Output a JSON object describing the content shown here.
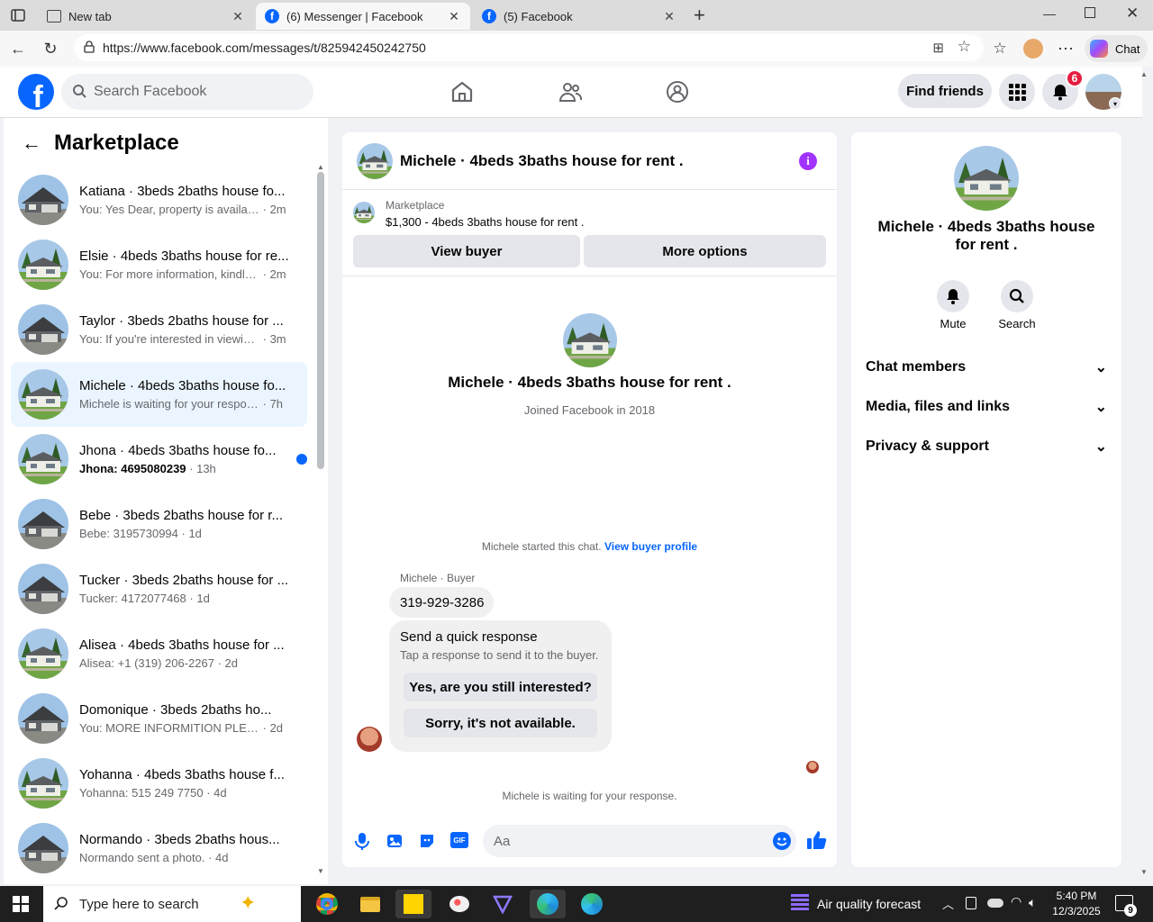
{
  "browser": {
    "tabs": [
      {
        "title": "New tab",
        "active": false
      },
      {
        "title": "(6) Messenger | Facebook",
        "active": true
      },
      {
        "title": "(5) Facebook",
        "active": false
      }
    ],
    "url": "https://www.facebook.com/messages/t/825942450242750",
    "copilot_label": "Chat"
  },
  "fb": {
    "search_placeholder": "Search Facebook",
    "find_friends": "Find friends",
    "notif_count": "6"
  },
  "sidebar": {
    "title": "Marketplace",
    "conversations": [
      {
        "name": "Katiana · 3beds 2baths house fo...",
        "preview": "You: Yes Dear, property is available...",
        "time": "2m",
        "house": "gray",
        "active": false,
        "bold": false,
        "unread": false
      },
      {
        "name": "Elsie · 4beds 3baths house for re...",
        "preview": "You: For more information, kindly s...",
        "time": "2m",
        "house": "white",
        "active": false,
        "bold": false,
        "unread": false
      },
      {
        "name": "Taylor · 3beds 2baths house for ...",
        "preview": "You: If you're interested in viewing ...",
        "time": "3m",
        "house": "gray",
        "active": false,
        "bold": false,
        "unread": false
      },
      {
        "name": "Michele · 4beds 3baths house fo...",
        "preview": "Michele is waiting for your response.",
        "time": "7h",
        "house": "white",
        "active": true,
        "bold": false,
        "unread": false
      },
      {
        "name": "Jhona · 4beds 3baths house fo...",
        "preview": "Jhona: 4695080239",
        "time": "13h",
        "house": "white",
        "active": false,
        "bold": true,
        "unread": true
      },
      {
        "name": "Bebe · 3beds 2baths house for r...",
        "preview": "Bebe: 3195730994",
        "time": "1d",
        "house": "gray",
        "active": false,
        "bold": false,
        "unread": false
      },
      {
        "name": "Tucker · 3beds 2baths house for ...",
        "preview": "Tucker: 4172077468",
        "time": "1d",
        "house": "gray",
        "active": false,
        "bold": false,
        "unread": false
      },
      {
        "name": "Alisea · 4beds 3baths house for ...",
        "preview": "Alisea: +1 (319) 206-2267",
        "time": "2d",
        "house": "white",
        "active": false,
        "bold": false,
        "unread": false
      },
      {
        "name": "Domonique · 3beds 2baths ho...",
        "preview": "You: MORE INFORMITION PLEA...",
        "time": "2d",
        "house": "gray",
        "active": false,
        "bold": false,
        "unread": false
      },
      {
        "name": "Yohanna · 4beds 3baths house f...",
        "preview": "Yohanna: 515 249 7750",
        "time": "4d",
        "house": "white",
        "active": false,
        "bold": false,
        "unread": false
      },
      {
        "name": "Normando · 3beds 2baths hous...",
        "preview": "Normando sent a photo.",
        "time": "4d",
        "house": "gray",
        "active": false,
        "bold": false,
        "unread": false
      }
    ]
  },
  "chat": {
    "title": "Michele · 4beds 3baths house for rent .",
    "marketplace_label": "Marketplace",
    "listing": "$1,300 - 4beds 3baths house for rent .",
    "view_buyer": "View buyer",
    "more_options": "More options",
    "profile_name": "Michele · 4beds 3baths house for rent .",
    "joined": "Joined Facebook in 2018",
    "started_text": "Michele started this chat.",
    "view_buyer_profile": "View buyer profile",
    "sender_label": "Michele · Buyer",
    "message": "319-929-3286",
    "quick_title": "Send a quick response",
    "quick_sub": "Tap a response to send it to the buyer.",
    "quick_1": "Yes, are you still interested?",
    "quick_2": "Sorry, it's not available.",
    "waiting": "Michele is waiting for your response.",
    "input_placeholder": "Aa"
  },
  "details": {
    "name": "Michele · 4beds 3baths house for rent .",
    "mute": "Mute",
    "search": "Search",
    "sections": [
      "Chat members",
      "Media, files and links",
      "Privacy & support"
    ]
  },
  "taskbar": {
    "search_placeholder": "Type here to search",
    "weather": "Air quality forecast",
    "time": "5:40 PM",
    "date": "12/3/2025",
    "notif": "9"
  }
}
